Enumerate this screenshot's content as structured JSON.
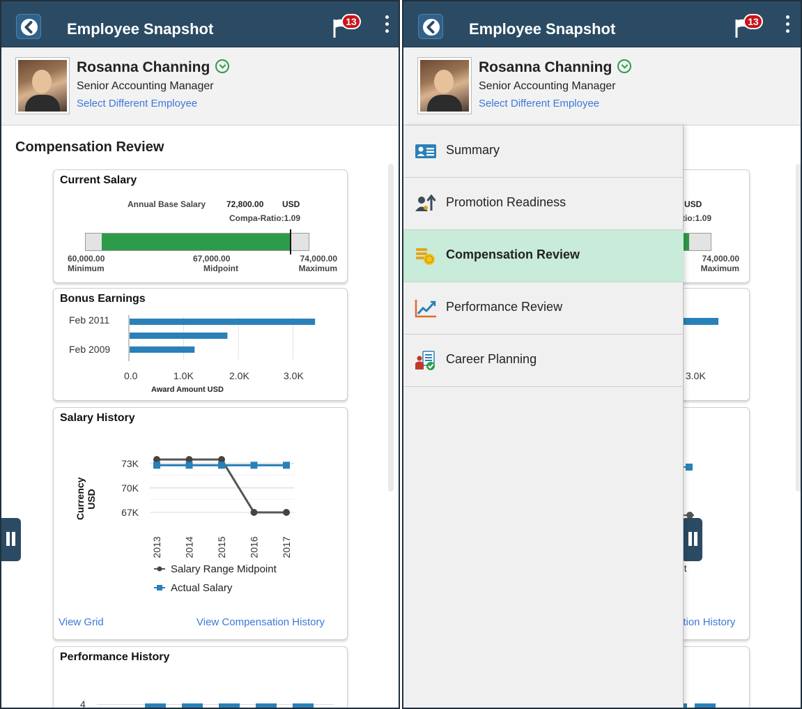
{
  "header": {
    "title": "Employee Snapshot",
    "notification_count": "13"
  },
  "employee": {
    "name": "Rosanna Channing",
    "job_title": "Senior Accounting Manager",
    "select_link": "Select Different Employee"
  },
  "section_title": "Compensation Review",
  "current_salary": {
    "title": "Current Salary",
    "annual_label": "Annual Base Salary",
    "annual_value": "72,800.00",
    "currency": "USD",
    "compa_ratio": "Compa-Ratio:1.09",
    "min_value": "60,000.00",
    "min_label": "Minimum",
    "mid_value": "67,000.00",
    "mid_label": "Midpoint",
    "max_value": "74,000.00",
    "max_label": "Maximum",
    "range_min": 60000,
    "range_max": 74000,
    "range_fill_from": 61000,
    "range_fill_to": 72800,
    "salary_marker": 72800
  },
  "bonus_earnings": {
    "title": "Bonus Earnings",
    "xlabel": "Award Amount USD",
    "y_tick_labels": [
      "Feb 2011",
      "Feb 2009"
    ],
    "x_tick_labels": [
      "0.0",
      "1.0K",
      "2.0K",
      "3.0K"
    ]
  },
  "salary_history": {
    "title": "Salary History",
    "ylabel": "Currency USD",
    "ylabel_line1": "Currency",
    "ylabel_line2": "USD",
    "legend_midpoint": "Salary Range Midpoint",
    "legend_actual": "Actual Salary",
    "view_grid_link": "View Grid",
    "view_comp_link": "View Compensation History"
  },
  "performance_history": {
    "title": "Performance History",
    "y_tick": "4"
  },
  "nav": {
    "items": [
      {
        "label": "Summary",
        "icon": "summary-icon",
        "selected": false
      },
      {
        "label": "Promotion Readiness",
        "icon": "promotion-icon",
        "selected": false
      },
      {
        "label": "Compensation Review",
        "icon": "coins-icon",
        "selected": true
      },
      {
        "label": "Performance Review",
        "icon": "chart-line-icon",
        "selected": false
      },
      {
        "label": "Career Planning",
        "icon": "career-icon",
        "selected": false
      }
    ]
  },
  "peek": {
    "usd": "USD",
    "compa": "tio:1.09",
    "max_value": "74,000.00",
    "max_label": "Maximum",
    "tick_3k": "3.0K",
    "year_2017": "2017",
    "legend_tail": "nt",
    "link_tail": "ation History"
  },
  "colors": {
    "header": "#2b4b64",
    "accent_green": "#2e9b4b",
    "series_blue": "#2a80b9",
    "series_gray": "#555555",
    "selected_nav": "#c9ebd9"
  },
  "chart_data": [
    {
      "type": "bar",
      "title": "Bonus Earnings",
      "orientation": "horizontal",
      "categories": [
        "Feb 2011",
        "",
        "Feb 2009"
      ],
      "values": [
        3400,
        1800,
        1200
      ],
      "xlabel": "Award Amount USD",
      "xlim": [
        0,
        3500
      ],
      "grid": true
    },
    {
      "type": "line",
      "title": "Salary History",
      "x": [
        "2013",
        "2014",
        "2015",
        "2016",
        "2017"
      ],
      "ylabel": "Currency USD",
      "y_ticks": [
        "67K",
        "70K",
        "73K"
      ],
      "ylim": [
        66000,
        74500
      ],
      "series": [
        {
          "name": "Salary Range Midpoint",
          "values": [
            73500,
            73500,
            73500,
            67000,
            67000
          ]
        },
        {
          "name": "Actual Salary",
          "values": [
            72800,
            72800,
            72800,
            72800,
            72800
          ]
        }
      ],
      "legend": "bottom"
    }
  ]
}
